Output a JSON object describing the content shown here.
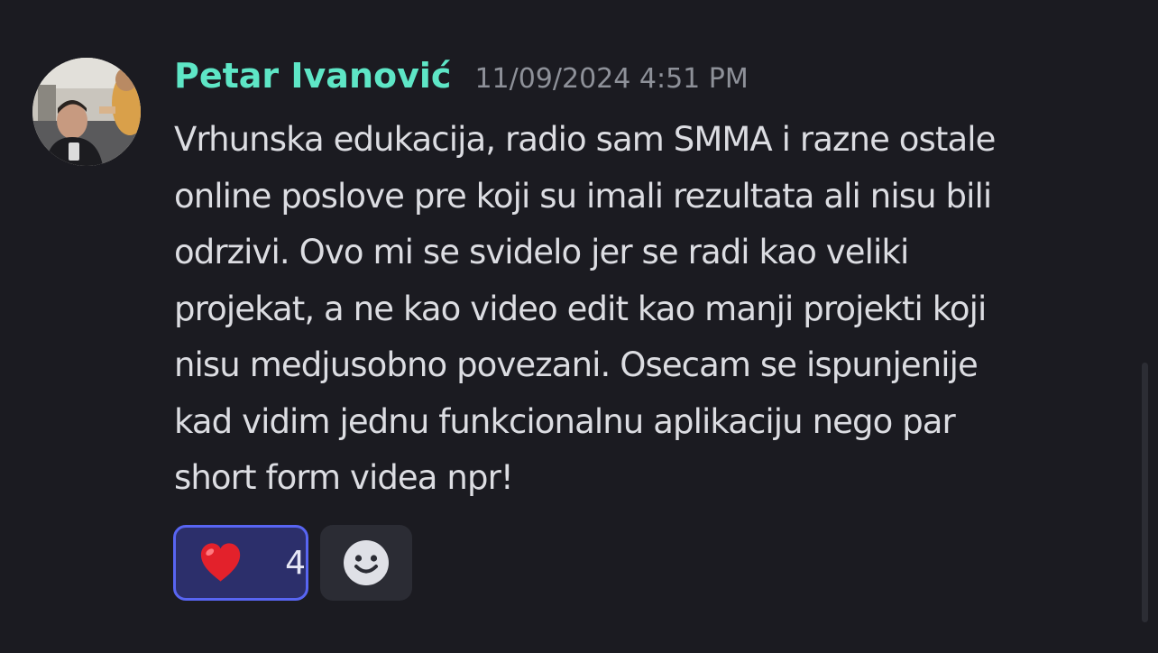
{
  "message": {
    "author": "Petar Ivanović",
    "timestamp": "11/09/2024 4:51 PM",
    "lines": [
      "Vrhunska edukacija, radio sam SMMA i razne ostale",
      "online poslove pre koji su imali rezultata ali nisu bili",
      "odrzivi. Ovo mi se svidelo jer se radi kao veliki",
      "projekat, a ne kao video edit kao manji projekti koji",
      "nisu medjusobno povezani. Osecam se ispunjenije",
      "kad vidim jednu funkcionalnu aplikaciju nego par",
      "short form videa npr!"
    ],
    "author_color": "#5ee6c6"
  },
  "reactions": [
    {
      "emoji": "heart-icon",
      "count": "4",
      "active": true
    }
  ],
  "add_reaction": {
    "icon": "smiley-add-reaction-icon"
  },
  "colors": {
    "background": "#1b1b21",
    "active_reaction_bg": "#2c2f6b",
    "active_reaction_border": "#5865f2",
    "text": "#dcdde2",
    "muted": "#8e9199"
  }
}
